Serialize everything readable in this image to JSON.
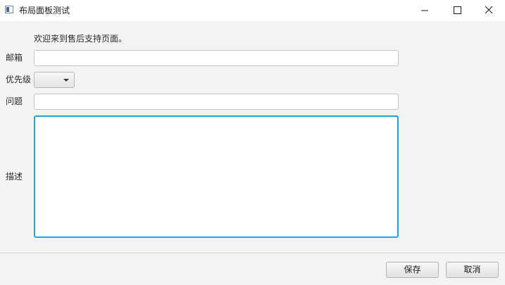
{
  "window": {
    "title": "布局面板测试",
    "controls": {
      "minimize_icon": "minimize-icon",
      "maximize_icon": "maximize-icon",
      "close_icon": "close-icon"
    }
  },
  "form": {
    "welcome_text": "欢迎来到售后支持页面。",
    "email": {
      "label": "邮箱",
      "value": ""
    },
    "priority": {
      "label": "优先级",
      "selected": ""
    },
    "question": {
      "label": "问题",
      "value": ""
    },
    "description": {
      "label": "描述",
      "value": ""
    }
  },
  "buttons": {
    "save": "保存",
    "cancel": "取消"
  },
  "colors": {
    "focus_border": "#20a4d8",
    "background": "#f3f3f3",
    "titlebar": "#ffffff"
  }
}
